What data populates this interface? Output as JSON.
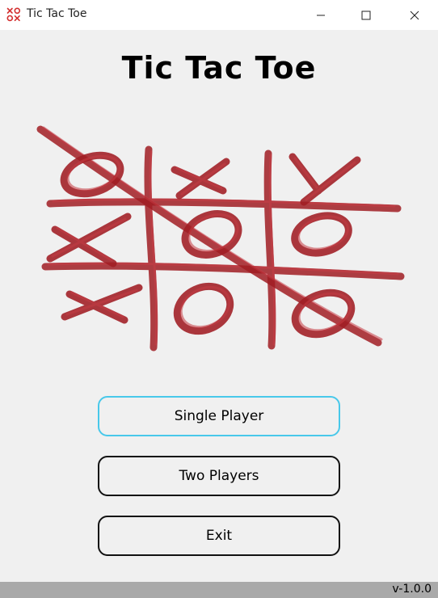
{
  "window": {
    "title": "Tic Tac Toe",
    "icon": "xo-app-icon"
  },
  "heading": "Tic Tac Toe",
  "logo": {
    "icon": "tic-tac-toe-board-illustration",
    "color": "#a51c24"
  },
  "menu": {
    "single_player": "Single Player",
    "two_players": "Two Players",
    "exit": "Exit"
  },
  "status": {
    "version": "v-1.0.0"
  },
  "colors": {
    "focus_border": "#48c8ea",
    "button_border": "#111111",
    "status_bar": "#a9a9a9",
    "background": "#f0f0f0"
  }
}
